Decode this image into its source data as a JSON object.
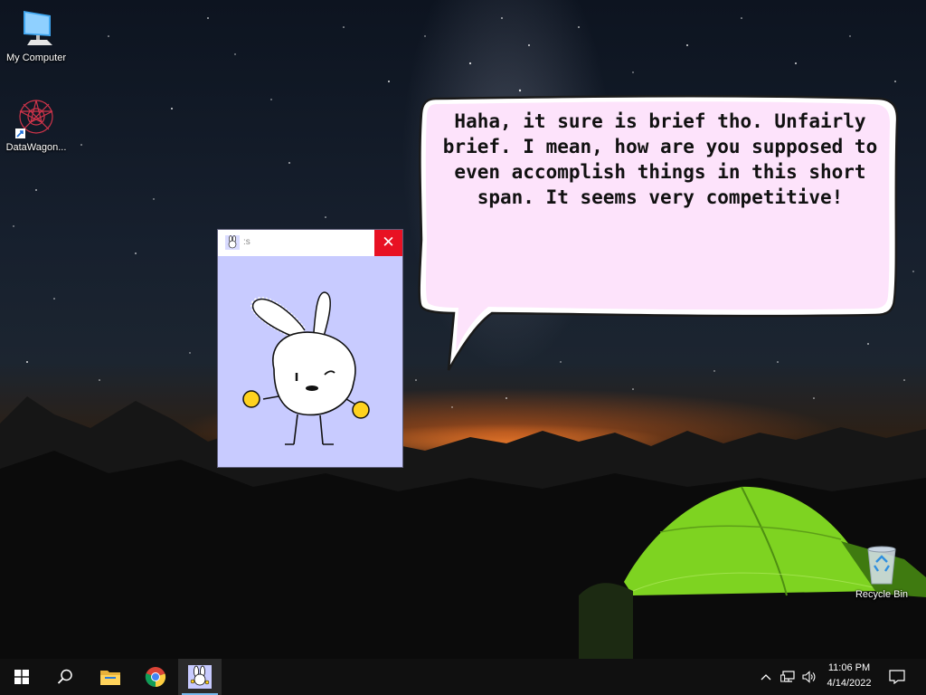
{
  "desktop": {
    "icons": [
      {
        "label": "My Computer",
        "icon": "computer-icon"
      },
      {
        "label": "DataWagon...",
        "icon": "datawagon-icon"
      },
      {
        "label": "Recycle Bin",
        "icon": "recycle-bin-icon"
      }
    ]
  },
  "bubble": {
    "text": "Haha, it sure is brief tho. Unfairly brief. I mean, how are you supposed to even accomplish things in this short span. It seems very competitive!",
    "fill_color": "#fde3fb",
    "border_color": "#1a1a1a"
  },
  "app_window": {
    "title": ":s",
    "close_label": "✕",
    "background_color": "#c8cbff",
    "character": "bunny-mascot"
  },
  "taskbar": {
    "start_icon": "windows-start-icon",
    "search_icon": "search-icon",
    "pinned": [
      {
        "name": "file-explorer-icon"
      },
      {
        "name": "chrome-icon"
      },
      {
        "name": "bunny-app-icon",
        "active": true
      }
    ],
    "tray": {
      "chevron": "^",
      "network_icon": "network-icon",
      "volume_icon": "volume-icon",
      "notification_icon": "notification-icon"
    },
    "clock": {
      "time": "11:06 PM",
      "date": "4/14/2022"
    }
  },
  "colors": {
    "taskbar_bg": "#101010",
    "close_button": "#e81123",
    "tent": "#7ed321"
  }
}
